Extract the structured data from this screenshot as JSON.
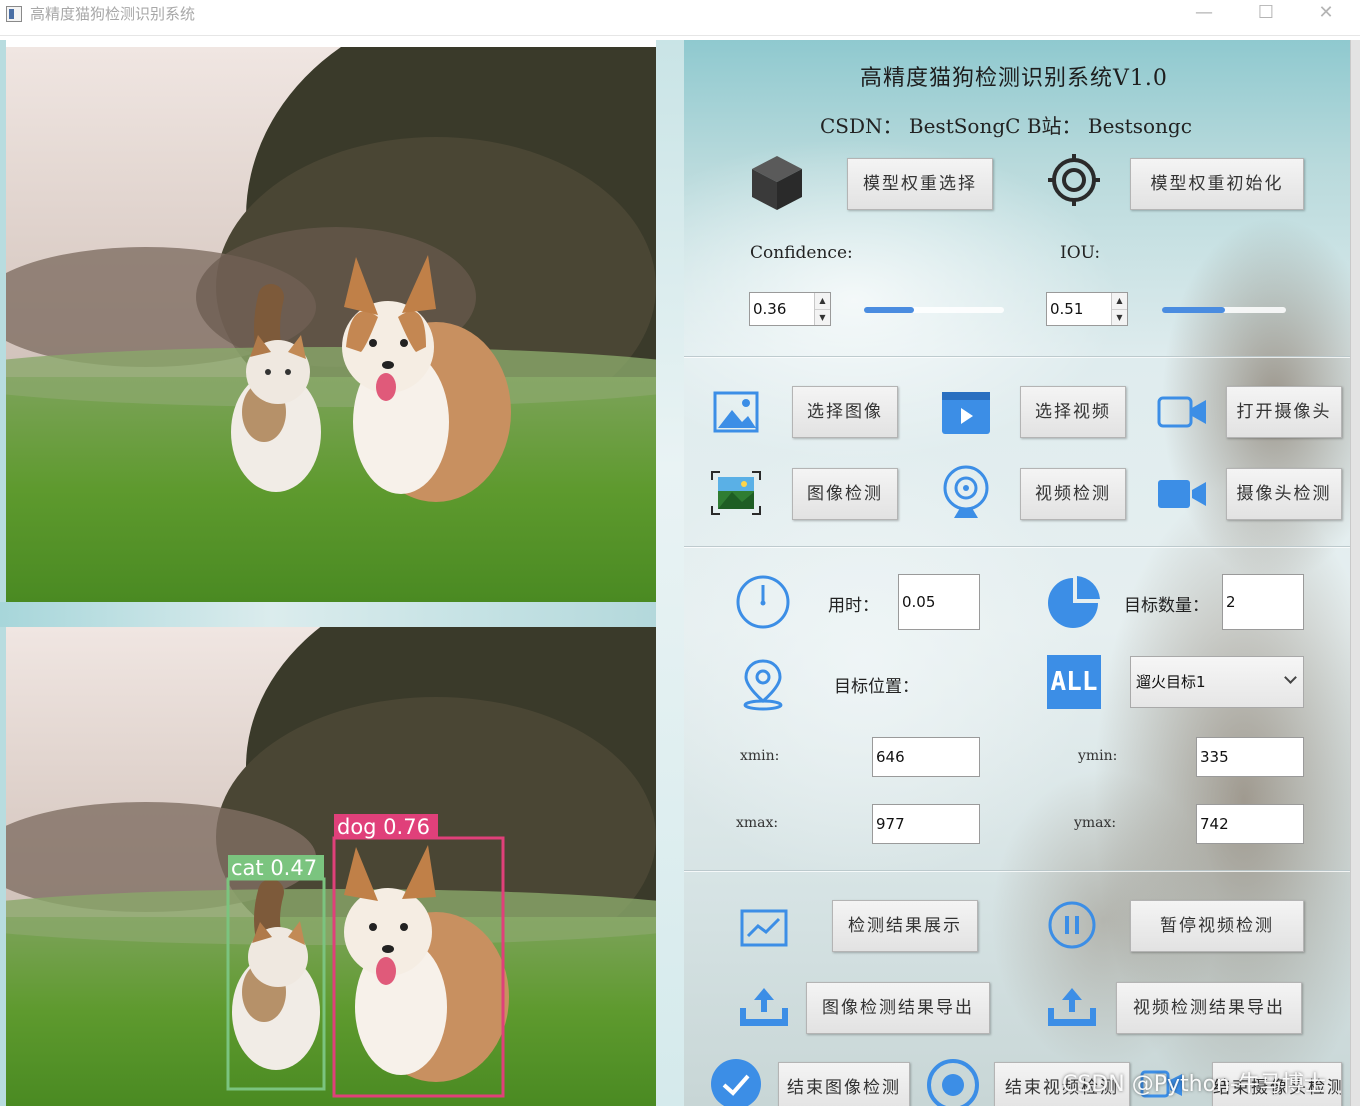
{
  "window": {
    "title": "高精度猫狗检测识别系统",
    "minimize_glyph": "—",
    "maximize_glyph": "☐",
    "close_glyph": "✕"
  },
  "header": {
    "title": "高精度猫狗检测识别系统V1.0",
    "csdn": "CSDN：  BestSongC    B站：  Bestsongc"
  },
  "model": {
    "select_weights_label": "模型权重选择",
    "init_weights_label": "模型权重初始化",
    "confidence_label": "Confidence:",
    "iou_label": "IOU:",
    "confidence_value": "0.36",
    "iou_value": "0.51",
    "confidence_level": 0.36,
    "iou_level": 0.51
  },
  "sources": {
    "select_image_label": "选择图像",
    "select_video_label": "选择视频",
    "open_camera_label": "打开摄像头",
    "image_detect_label": "图像检测",
    "video_detect_label": "视频检测",
    "camera_detect_label": "摄像头检测"
  },
  "results": {
    "time_label": "用时：",
    "time_value": "0.05",
    "count_label": "目标数量：",
    "count_value": "2",
    "position_label": "目标位置：",
    "target_select_value": "遛火目标1",
    "all_badge": "ALL",
    "xmin_label": "xmin:",
    "xmin_value": "646",
    "ymin_label": "ymin:",
    "ymin_value": "335",
    "xmax_label": "xmax:",
    "xmax_value": "977",
    "ymax_label": "ymax:",
    "ymax_value": "742"
  },
  "actions": {
    "show_results_label": "检测结果展示",
    "pause_video_label": "暂停视频检测",
    "export_image_label": "图像检测结果导出",
    "export_video_label": "视频检测结果导出",
    "end_image_label": "结束图像检测",
    "end_video_label": "结束视频检测",
    "end_camera_label": "结束摄像头检测"
  },
  "detections": [
    {
      "label": "cat 0.47",
      "color": "#7bc47f"
    },
    {
      "label": "dog 0.76",
      "color": "#e0407a"
    }
  ],
  "watermark": "CSDN @Python-牛马博士",
  "colors": {
    "accent": "#4a8ce0",
    "cat_box": "#7bc47f",
    "dog_box": "#e0407a"
  }
}
